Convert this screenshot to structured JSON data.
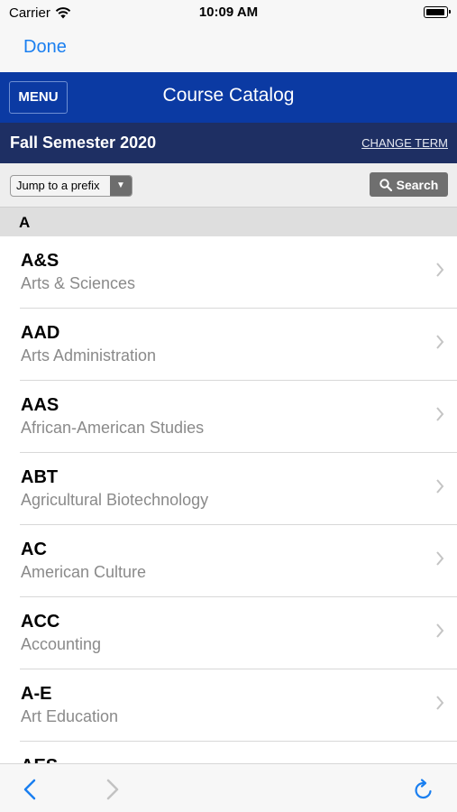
{
  "status": {
    "carrier": "Carrier",
    "time": "10:09 AM"
  },
  "nav": {
    "done_label": "Done"
  },
  "app": {
    "menu_label": "MENU",
    "title": "Course Catalog"
  },
  "term": {
    "title": "Fall Semester 2020",
    "change_label": "CHANGE TERM"
  },
  "toolbar": {
    "jump_label": "Jump to a prefix",
    "search_label": "Search"
  },
  "section": {
    "letter": "A"
  },
  "courses": [
    {
      "code": "A&S",
      "name": "Arts & Sciences"
    },
    {
      "code": "AAD",
      "name": "Arts Administration"
    },
    {
      "code": "AAS",
      "name": "African-American Studies"
    },
    {
      "code": "ABT",
      "name": "Agricultural Biotechnology"
    },
    {
      "code": "AC",
      "name": "American Culture"
    },
    {
      "code": "ACC",
      "name": "Accounting"
    },
    {
      "code": "A-E",
      "name": "Art Education"
    },
    {
      "code": "AES",
      "name": ""
    }
  ],
  "colors": {
    "accent": "#1a7ff0",
    "app_bar": "#0b3aa3",
    "term_bar": "#1e2f63"
  }
}
